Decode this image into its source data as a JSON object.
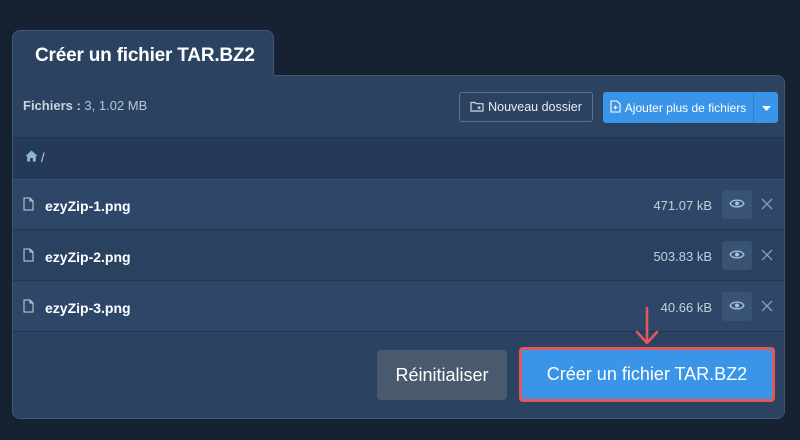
{
  "tab": {
    "title": "Créer un fichier TAR.BZ2"
  },
  "toolbar": {
    "files_label": "Fichiers :",
    "files_summary": "3, 1.02 MB",
    "new_folder_label": "Nouveau dossier",
    "add_files_label": "Ajouter plus de fichiers"
  },
  "breadcrumb": {
    "path": "/"
  },
  "files": [
    {
      "name": "ezyZip-1.png",
      "size": "471.07 kB"
    },
    {
      "name": "ezyZip-2.png",
      "size": "503.83 kB"
    },
    {
      "name": "ezyZip-3.png",
      "size": "40.66 kB"
    }
  ],
  "footer": {
    "reset_label": "Réinitialiser",
    "create_label": "Créer un fichier TAR.BZ2"
  },
  "colors": {
    "accent": "#3a95e8",
    "highlight": "#e0575c",
    "panel": "#2b4261",
    "background": "#162131"
  },
  "icons": [
    "home-icon",
    "folder-plus-icon",
    "file-icon",
    "eye-icon",
    "close-icon",
    "caret-down-icon",
    "arrow-down-icon"
  ]
}
